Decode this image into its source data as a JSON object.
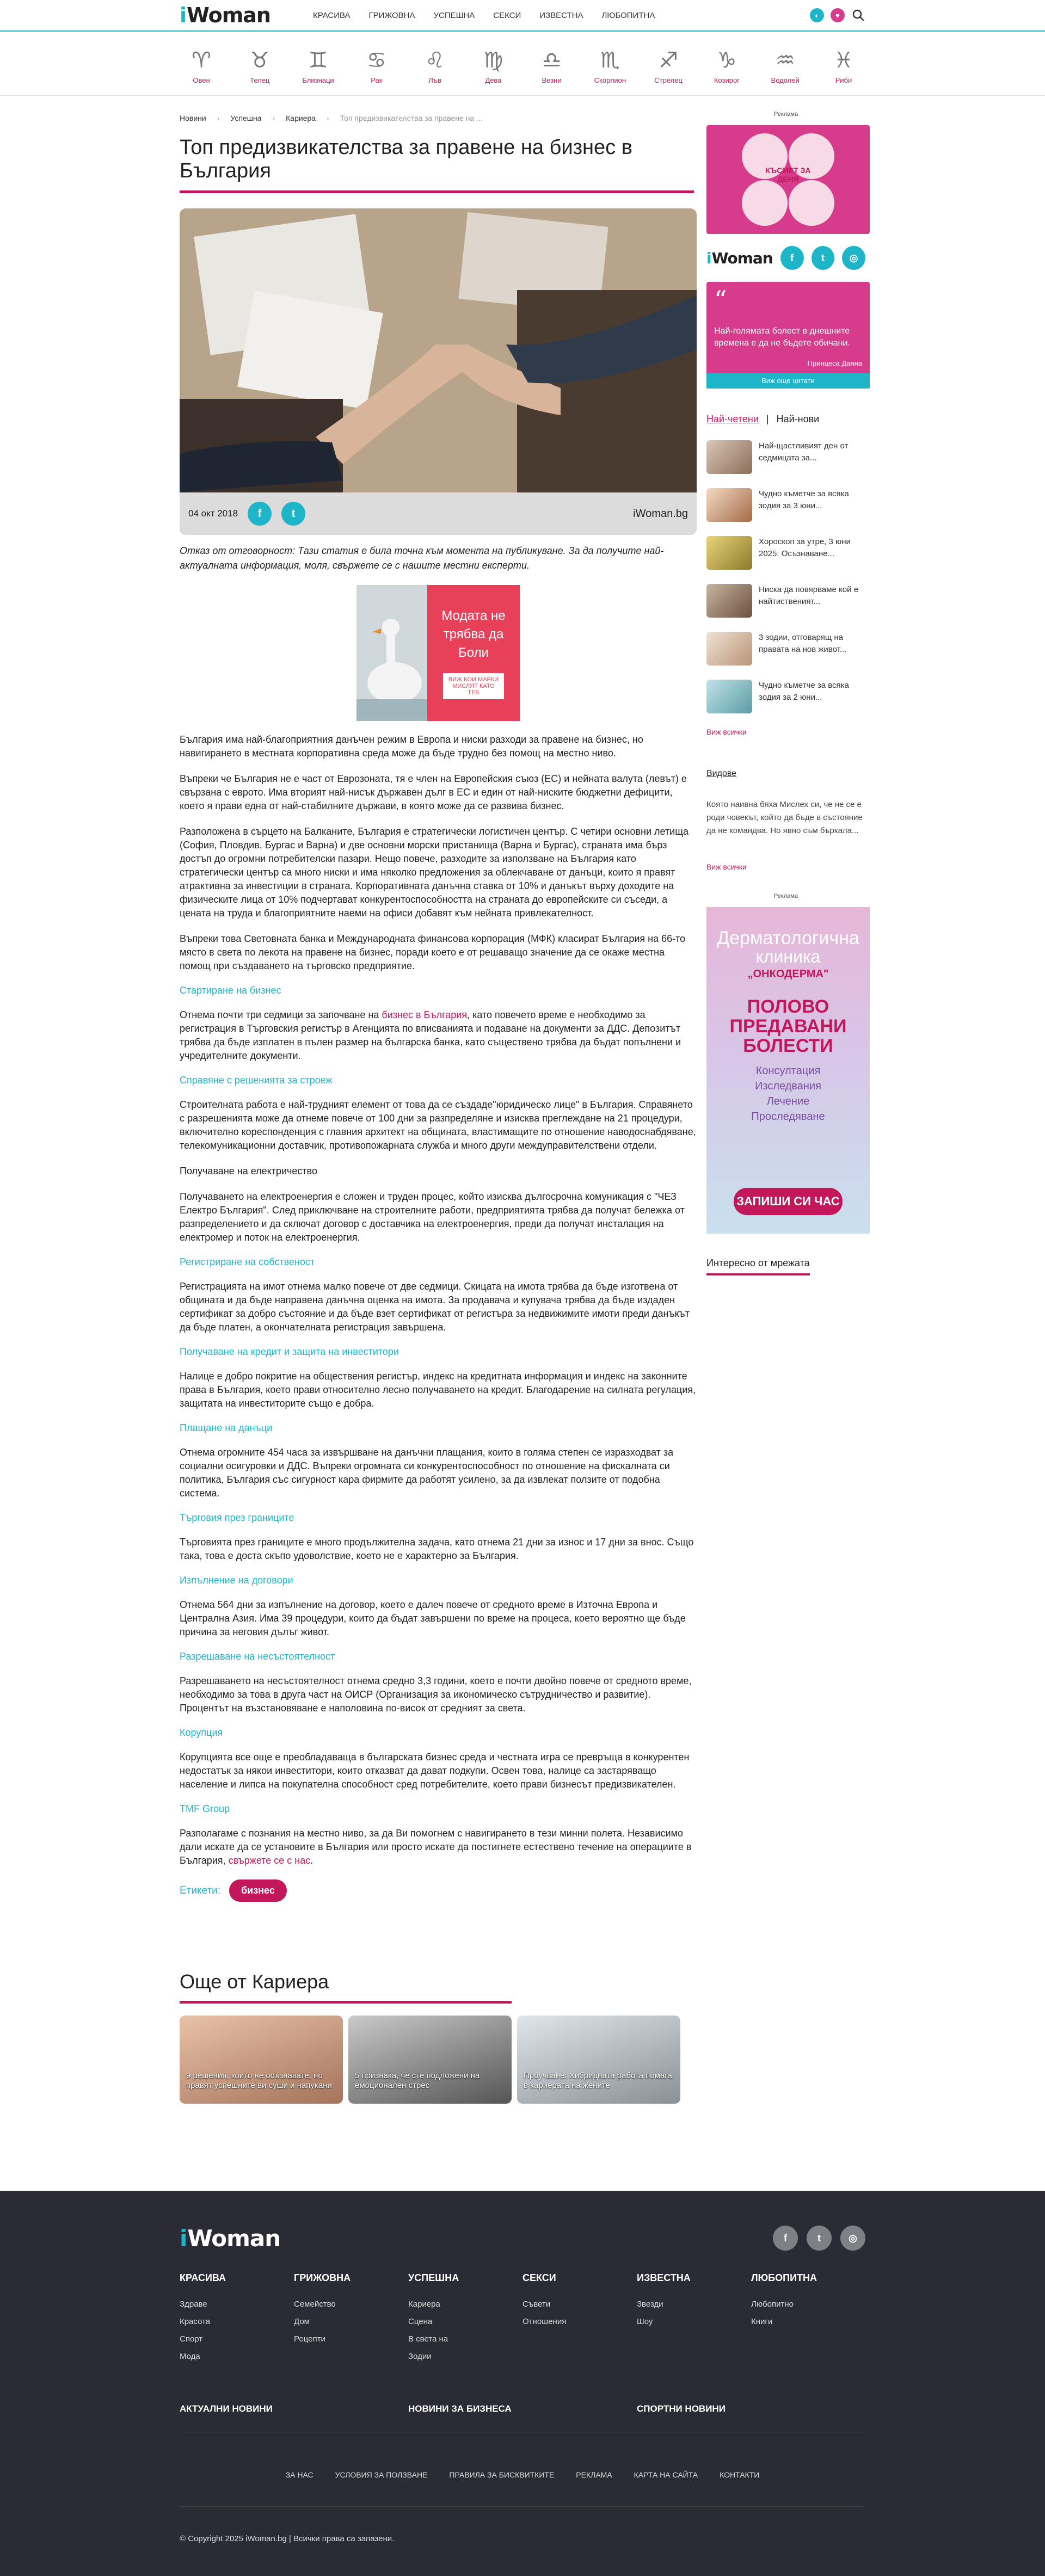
{
  "header": {
    "logo_i": "i",
    "logo_rest": "Woman",
    "nav": [
      "Красива",
      "Грижовна",
      "Успешна",
      "Секси",
      "Известна",
      "Любопитна"
    ]
  },
  "zodiac": [
    {
      "glyph": "♈",
      "label": "Овен"
    },
    {
      "glyph": "♉",
      "label": "Телец"
    },
    {
      "glyph": "♊",
      "label": "Близнаци"
    },
    {
      "glyph": "♋",
      "label": "Рак"
    },
    {
      "glyph": "♌",
      "label": "Лъв"
    },
    {
      "glyph": "♍",
      "label": "Дева"
    },
    {
      "glyph": "♎",
      "label": "Везни"
    },
    {
      "glyph": "♏",
      "label": "Скорпион"
    },
    {
      "glyph": "♐",
      "label": "Стрелец"
    },
    {
      "glyph": "♑",
      "label": "Козирог"
    },
    {
      "glyph": "♒",
      "label": "Водолей"
    },
    {
      "glyph": "♓",
      "label": "Риби"
    }
  ],
  "breadcrumb": [
    "Новини",
    "Успешна",
    "Кариера",
    "Топ предизвикателства за правене на ..."
  ],
  "article": {
    "title": "Топ предизвикателства за правене на бизнес в България",
    "date": "04 окт 2018",
    "source": "iWoman.bg",
    "disclaimer": "Отказ от отговорност: Тази статия е била точна към момента на публикуване. За да получите най-актуалната информация, моля, свържете се с нашите местни експерти.",
    "p1": "България има най-благоприятния данъчен режим в Европа и ниски разходи за правене на бизнес, но навигирането в местната корпоративна среда може да бъде трудно без помощ на местно ниво.",
    "p2": "Въпреки че България не е част от Еврозоната, тя е член на Европейския съюз (ЕС) и нейната валута (левът) е свързана с еврото. Има вторият най-нисък държавен дълг в ЕС и един от най-ниските бюджетни дефицити, което я прави една от най-стабилните държави, в която може да се развива бизнес.",
    "p3": "Разположена в сърцето на Балканите, България е стратегически логистичен център. С четири основни летища (София, Пловдив, Бургас и Варна) и две основни морски пристанища (Варна и Бургас), страната има бърз достъп до огромни потребителски пазари. Нещо повече, разходите за използване на България като стратегически център са много ниски и има няколко предложения за облекчаване от данъци, които я правят атрактивна за инвестиции в страната. Корпоративната данъчна ставка от 10% и данъкът върху доходите на физическите лица от 10% подчертават конкурентоспособността на страната до европейските си съседи, а цената на труда и благоприятните наеми на офиси добавят към нейната привлекателност.",
    "p4": "Въпреки това Световната банка и Международната финансова корпорация (МФК) класират България на 66-то място в света по лекота на правене на бизнес, поради което е от решаващо значение да се окаже местна помощ при създаването на търговско предприятие.",
    "h1": "Стартиране на бизнес",
    "p5a": "Отнема почти три седмици за започване на ",
    "p5link": "бизнес в България",
    "p5b": ", като повечето време е необходимо за регистрация в Търговския регистър в Агенцията по вписванията и подаване на документи за ДДС. Депозитът трябва да бъде изплатен в пълен размер на българска банка, като съществено трябва да бъдат попълнени и учредителните документи.",
    "h2": "Справяне с решенията за строеж",
    "p6": "Строителната работа е най-трудният елемент от това да се създаде\"юридическо лице\" в България. Справянето с разрешенията може да отнеме повече от 100 дни за разпределяне и изисква преглеждане на 21 процедури, включително кореспонденция с главния архитект на общината, властимащите по отношение наводоснабдяване, телекомуникационни доставчик, противопожарната служба и много други междуправителствени отдели.",
    "p7": "Получаване на електричество",
    "p8": "Получаването на електроенергия е сложен и труден процес, който изисква дългосрочна комуникация с \"ЧЕЗ Електро България\". След приключване на строителните работи, предприятията трябва да получат бележка от разпределението и да сключат договор с доставчика на електроенергия, преди да получат инсталация на електромер и поток на електроенергия.",
    "h3": "Регистриране на собственост",
    "p9": "Регистрацията на имот отнема малко повече от две седмици. Скицата на имота трябва да бъде изготвена от общината и да бъде направена данъчна оценка на имота. За продавача и купувача трябва да бъде издаден сертификат за добро състояние и да бъде взет сертификат от регистъра за недвижимите имоти преди данъкът да бъде платен, а окончателната регистрация завършена.",
    "h4": "Получаване на кредит и защита на инвеститори",
    "p10": "Налице е добро покритие на обществения регистър, индекс на кредитната информация и индекс на законните права в България, което прави относително лесно получаването на кредит. Благодарение на силната регулация, защитата на инвеститорите също е добра.",
    "h5": "Плащане на данъци",
    "p11": "Отнема огромните 454 часа за извършване на данъчни плащания, които в голяма степен се изразходват за социални осигуровки и ДДС. Въпреки огромната си конкурентоспособност по отношение на фискалната си политика, България със сигурност кара фирмите да работят усилено, за да извлекат ползите от подобна система.",
    "h6": "Търговия през границите",
    "p12": "Търговията през границите е много продължителна задача, като отнема 21 дни за износ и 17 дни за внос. Също така, това е доста скъпо удоволствие, което не е характерно за България.",
    "h7": "Изпълнение на договори",
    "p13": "Отнема 564 дни за изпълнение на договор, което е далеч повече от средното време в Източна Европа и Централна Азия. Има 39 процедури, които да бъдат завършени по време на процеса, което вероятно ще бъде причина за неговия дълъг живот.",
    "h8": "Разрешаване на несъстоятелност",
    "p14": "Разрешаването на несъстоятелност отнема средно 3,3 години, което е почти двойно повече от средното време, необходимо за това в друга част на ОИСР (Организация за икономическо сътрудничество и развитие). Процентът на възстановяване е наполовина по-висок от средният за света.",
    "h9": "Корупция",
    "p15": "Корупцията все още е преобладаваща в българската бизнес среда и честната игра се превръща в конкурентен недостатък за някои инвеститори, които отказват да дават подкупи. Освен това, налице са застаряващо население и липса на покупателна способност сред потребителите, което прави бизнесът предизвикателен.",
    "h10": "TMF Group",
    "p16a": "Разполагаме с познания на местно ниво, за да Ви помогнем с навигирането в тези минни полета. Независимо дали искате да се установите в България или просто искате да постигнете естествено течение на операциите в България, ",
    "p16link": "свържете се с нас",
    "p16b": ".",
    "tags_label": "Етикети:",
    "tag": "бизнес"
  },
  "ad1": {
    "text": "Модата не трябва да Боли",
    "btn": "ВИЖ КОИ МАРКИ МИСЛЯТ КАТО ТЕБ"
  },
  "more": {
    "title": "Още от Кариера",
    "cards": [
      "9 решения, които не осъзнавате, но правят успешните ви суши и напукани",
      "5 признака, че сте подложени на емоционален стрес",
      "Проучване: Хибридната работа помага в кариерата на жените"
    ]
  },
  "sidebar": {
    "ad_label": "Реклама",
    "clover_text": "КЪСМЕТ ЗА ДЕНЯ",
    "quote": "Най-голямата болест в днешните времена е да не бъдете обичани.",
    "quote_author": "Принцеса Даяна",
    "quote_btn": "Виж още цитати",
    "tab_active": "Най-четени",
    "tab_other": "Най-нови",
    "list": [
      "Най-щастливият ден от седмицата за...",
      "Чудно къметче за всяка зодия за 3 юни...",
      "Хороскоп за утре, 3 юни 2025: Осъзнаване...",
      "Ниска да повярваме кой е найтиственият...",
      "3 зодии, отговарящ на правата на нов живот...",
      "Чудно къметче за всяка зодия за 2 юни..."
    ],
    "see_all": "Виж всички",
    "video": "Видове",
    "video_text": "Която наивна бяха Мислех си, че не се е роди човекът, който да бъде в състояние да не командва. Но явно съм бъркала...",
    "see_all2": "Виж всички",
    "ad2": {
      "h1": "Дерматологична",
      "h2": "клиника",
      "h2b": "„ОНКОДЕРМА\"",
      "h3": "ПОЛОВО ПРЕДАВАНИ БОЛЕСТИ",
      "items": [
        "Консултация",
        "Изследвания",
        "Лечение",
        "Проследяване"
      ],
      "cta": "ЗАПИШИ СИ ЧАС"
    },
    "net": "Интересно от мрежата"
  },
  "footer": {
    "cols": [
      {
        "h": "КРАСИВА",
        "items": [
          "Здраве",
          "Красота",
          "Спорт",
          "Мода"
        ]
      },
      {
        "h": "ГРИЖОВНА",
        "items": [
          "Семейство",
          "Дом",
          "Рецепти"
        ]
      },
      {
        "h": "УСПЕШНА",
        "items": [
          "Кариера",
          "Сцена",
          "В света на",
          "Зодии"
        ]
      },
      {
        "h": "СЕКСИ",
        "items": [
          "Съвети",
          "Отношения"
        ]
      },
      {
        "h": "ИЗВЕСТНА",
        "items": [
          "Звезди",
          "Шоу"
        ]
      },
      {
        "h": "ЛЮБОПИТНА",
        "items": [
          "Любопитно",
          "Книги"
        ]
      }
    ],
    "news": [
      "АКТУАЛНИ НОВИНИ",
      "НОВИНИ ЗА БИЗНЕСА",
      "СПОРТНИ НОВИНИ"
    ],
    "links": [
      "ЗА НАС",
      "УСЛОВИЯ ЗА ПОЛЗВАНЕ",
      "ПРАВИЛА ЗА БИСКВИТКИТЕ",
      "РЕКЛАМА",
      "КАРТА НА САЙТА",
      "КОНТАКТИ"
    ],
    "copy": "© Copyright 2025 iWoman.bg | Всички права са запазени."
  }
}
